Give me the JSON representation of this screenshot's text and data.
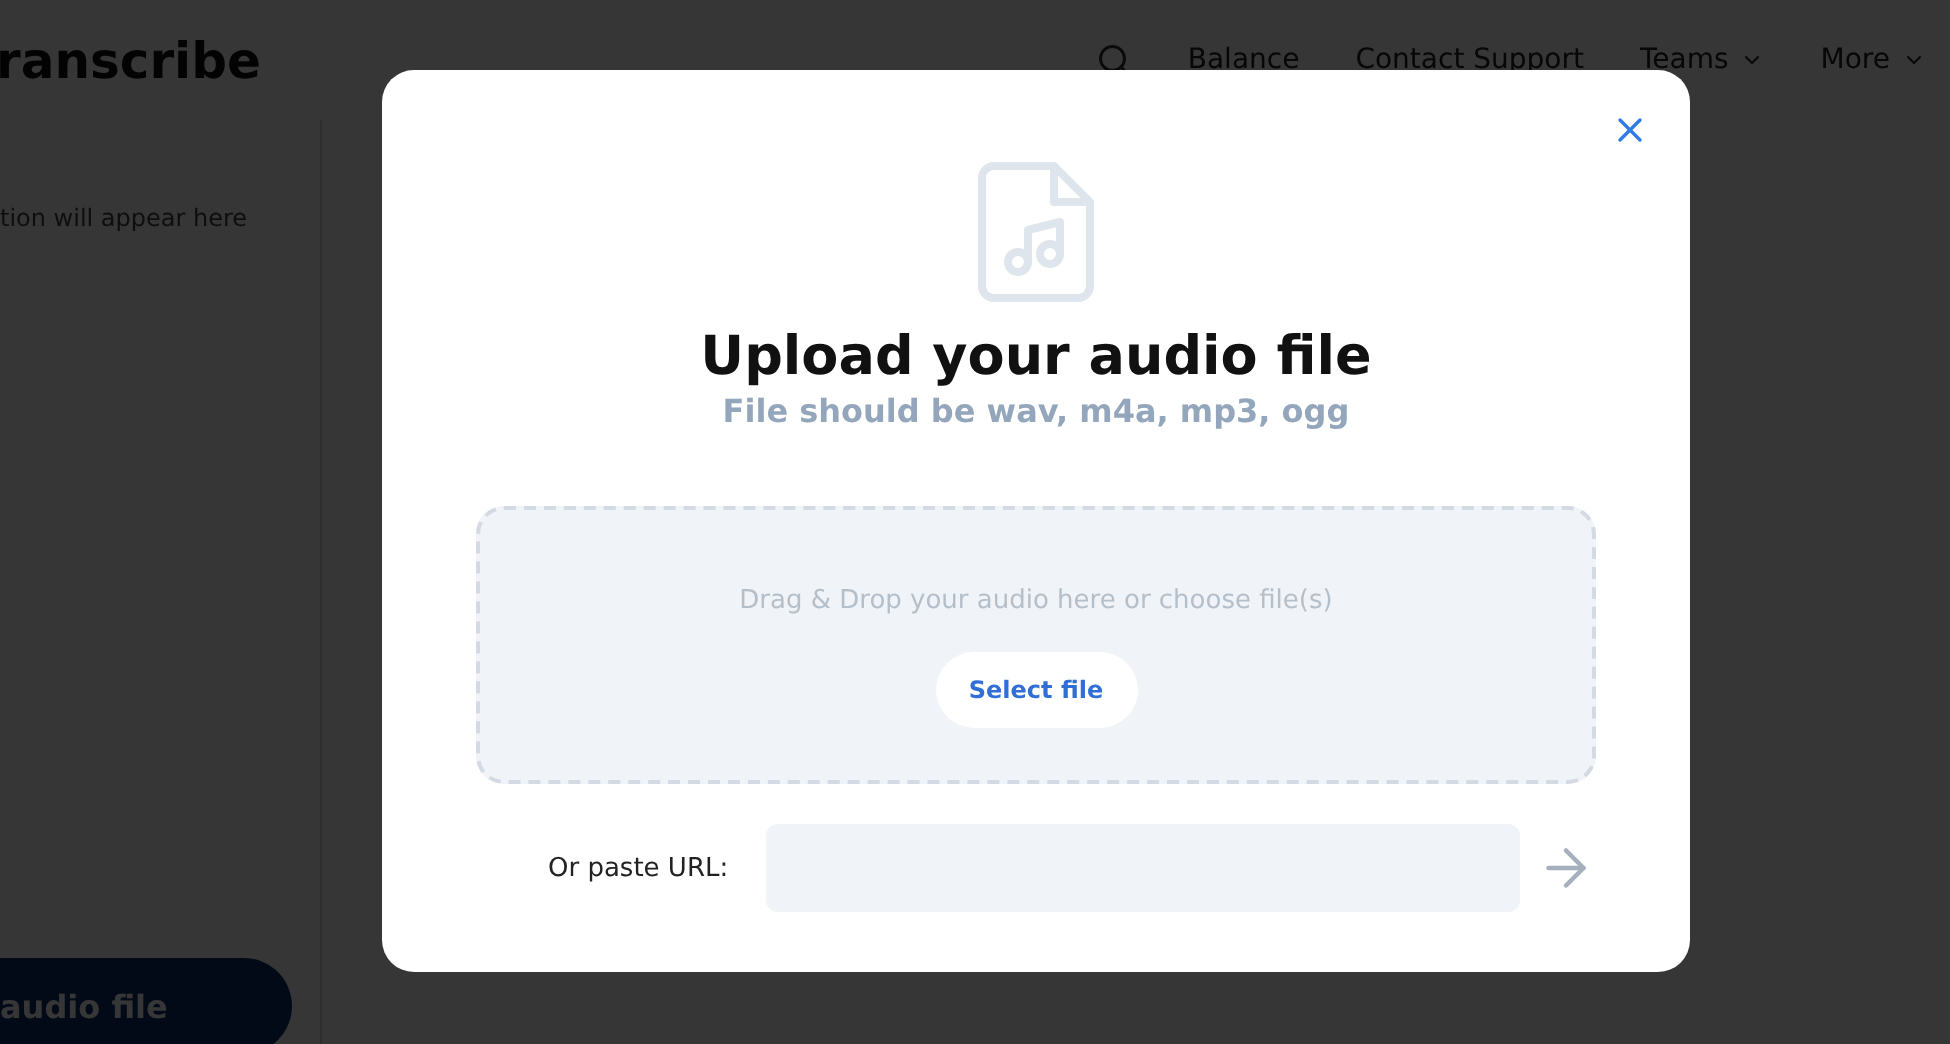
{
  "header": {
    "logo": "ranscribe",
    "nav": [
      {
        "label": "Balance",
        "dropdown": false
      },
      {
        "label": "Contact Support",
        "dropdown": false
      },
      {
        "label": "Teams",
        "dropdown": true
      },
      {
        "label": "More",
        "dropdown": true
      }
    ]
  },
  "sidebar": {
    "hint": "tion will appear here",
    "button": "audio file"
  },
  "modal": {
    "title": "Upload your audio file",
    "subtitle": "File should be wav, m4a, mp3, ogg",
    "dropzone": {
      "text": "Drag & Drop your audio here or choose file(s)",
      "button": "Select file"
    },
    "url": {
      "label": "Or paste URL:"
    }
  }
}
